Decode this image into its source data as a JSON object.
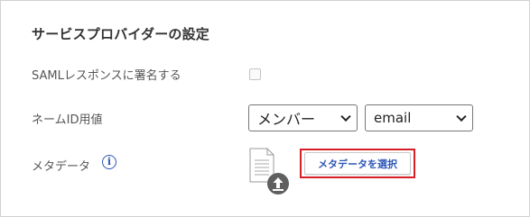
{
  "section": {
    "title": "サービスプロバイダーの設定"
  },
  "fields": {
    "saml_sign": {
      "label": "SAMLレスポンスに署名する",
      "checked": false
    },
    "name_id": {
      "label": "ネームID用値",
      "member_select": {
        "selected": "メンバー"
      },
      "attribute_select": {
        "selected": "email"
      }
    },
    "metadata": {
      "label": "メタデータ",
      "info_icon": "info-icon",
      "file_icon": "document-upload-icon",
      "button_label": "メタデータを選択"
    }
  },
  "colors": {
    "accent": "#2f57b7",
    "highlight": "#d61f26",
    "label_text": "#555555",
    "title_text": "#333333"
  }
}
